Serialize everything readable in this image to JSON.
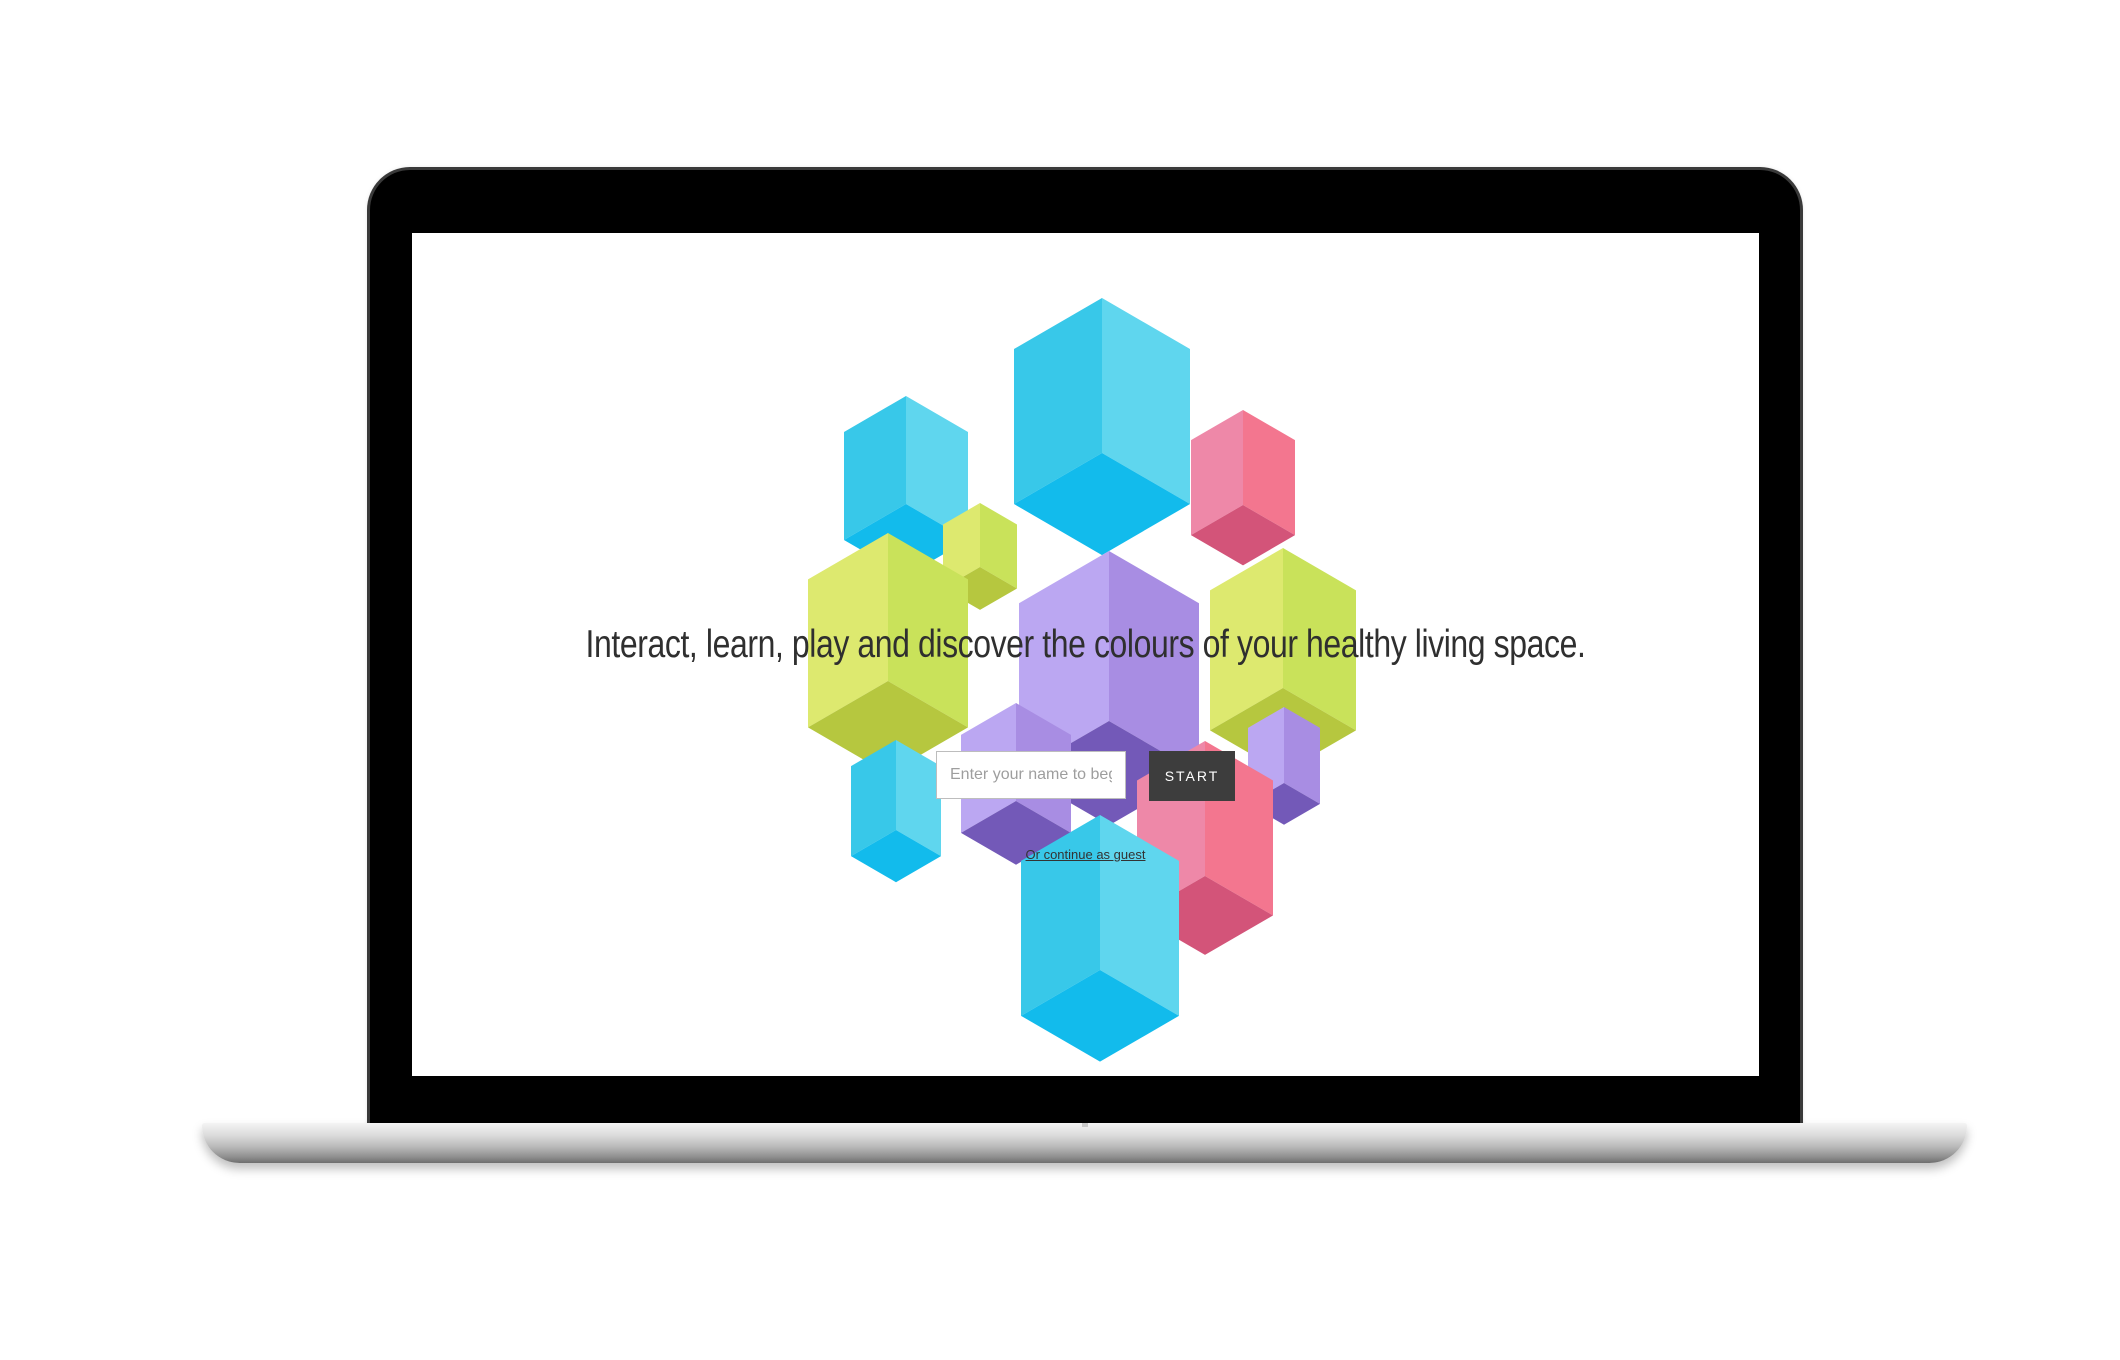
{
  "headline": "Interact, learn, play and discover the colours of your healthy living space.",
  "name_input": {
    "placeholder": "Enter your name to begin",
    "value": ""
  },
  "start_button": {
    "label": "START"
  },
  "guest_link": {
    "label": "Or continue as guest"
  },
  "colors": {
    "cyan": [
      "#5fd6ee",
      "#38c8e9",
      "#12bbec"
    ],
    "pink": [
      "#f3768f",
      "#ee88a8",
      "#d35479"
    ],
    "lime": [
      "#c9e25a",
      "#dde96f",
      "#b6c73f"
    ],
    "purple": [
      "#a88de3",
      "#bba7f2",
      "#7359b8"
    ]
  }
}
